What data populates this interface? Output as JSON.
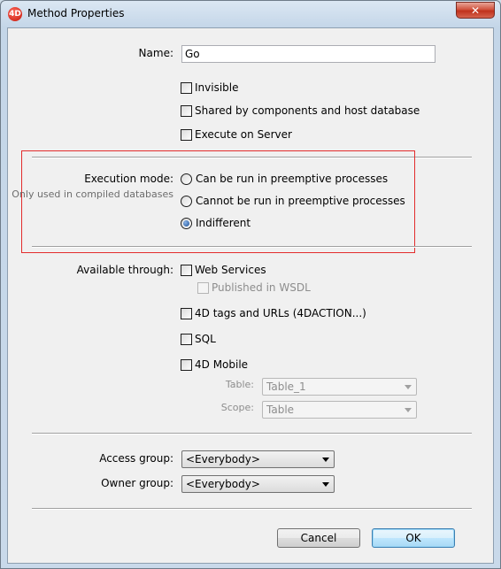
{
  "window": {
    "title": "Method Properties",
    "app_icon_text": "4D",
    "close_glyph": "✕"
  },
  "name_field": {
    "label": "Name:",
    "value": "Go"
  },
  "options": [
    {
      "label": "Invisible",
      "checked": false
    },
    {
      "label": "Shared by components and host database",
      "checked": false
    },
    {
      "label": "Execute on Server",
      "checked": false
    }
  ],
  "execution_mode": {
    "label": "Execution mode:",
    "sublabel": "Only used in compiled databases",
    "choices": [
      {
        "label": "Can be run in preemptive processes",
        "selected": false
      },
      {
        "label": "Cannot be run in preemptive processes",
        "selected": false
      },
      {
        "label": "Indifferent",
        "selected": true
      }
    ]
  },
  "available_through": {
    "label": "Available through:",
    "web_services": "Web Services",
    "published_wsdl": "Published in WSDL",
    "tags_urls": "4D tags and URLs (4DACTION...)",
    "sql": "SQL",
    "mobile": "4D Mobile",
    "table_label": "Table:",
    "table_value": "Table_1",
    "scope_label": "Scope:",
    "scope_value": "Table"
  },
  "access": {
    "access_label": "Access group:",
    "access_value": "<Everybody>",
    "owner_label": "Owner group:",
    "owner_value": "<Everybody>"
  },
  "buttons": {
    "cancel": "Cancel",
    "ok": "OK"
  },
  "colors": {
    "highlight_border": "#e32c2c",
    "ok_border": "#3c7fb1"
  }
}
